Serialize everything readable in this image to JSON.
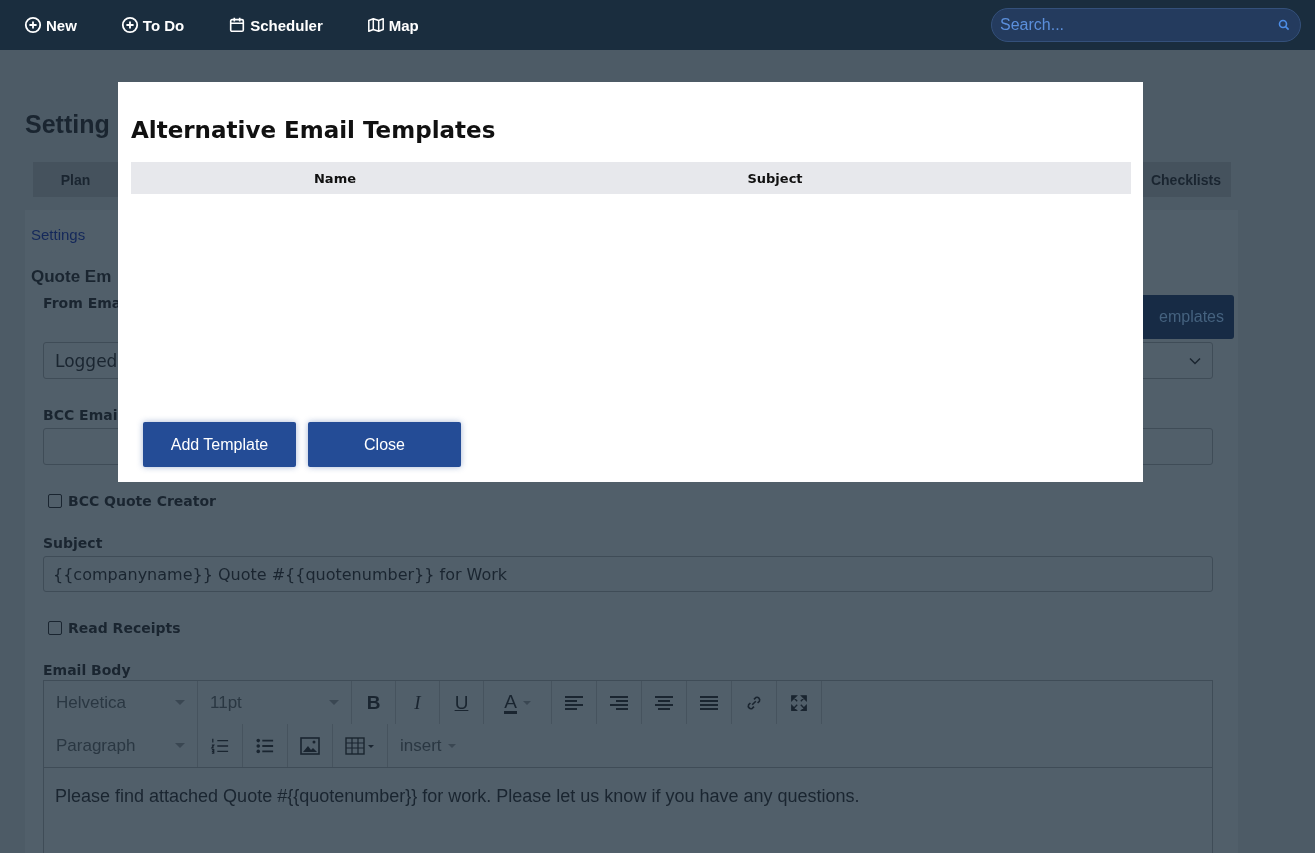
{
  "topbar": {
    "items": [
      {
        "kind": "plus",
        "label": "New"
      },
      {
        "kind": "plus",
        "label": "To Do"
      },
      {
        "kind": "calendar",
        "label": "Scheduler"
      },
      {
        "kind": "map",
        "label": "Map"
      }
    ],
    "search": {
      "placeholder": "Search..."
    }
  },
  "page": {
    "title": "Setting",
    "tabs": [
      {
        "label": "Plan",
        "selected": false
      },
      {
        "label": "Checklists",
        "selected": false
      }
    ],
    "breadcrumb": [
      "Settings"
    ],
    "section_title": "Quote Em",
    "from_email": {
      "label": "From Ema",
      "value": "Logged"
    },
    "templates_button": "emplates",
    "bcc_email": {
      "label": "BCC Emai"
    },
    "bcc_quote_creator": {
      "label": "BCC Quote Creator",
      "checked": false
    },
    "subject": {
      "label": "Subject",
      "value": "{{companyname}} Quote #{{quotenumber}} for Work"
    },
    "read_receipts": {
      "label": "Read Receipts",
      "checked": false
    },
    "email_body": {
      "label": "Email Body",
      "toolbar_rows": [
        [
          {
            "kind": "select",
            "label": "Helvetica"
          },
          {
            "kind": "select",
            "label": "11pt"
          },
          {
            "kind": "bold",
            "label": "B"
          },
          {
            "kind": "italic",
            "label": "I"
          },
          {
            "kind": "underline",
            "label": "U"
          },
          {
            "kind": "color",
            "label": "A"
          },
          {
            "kind": "align-left"
          },
          {
            "kind": "align-right"
          },
          {
            "kind": "align-center"
          },
          {
            "kind": "justify"
          },
          {
            "kind": "link"
          },
          {
            "kind": "fullscreen"
          }
        ],
        [
          {
            "kind": "select",
            "label": "Paragraph"
          },
          {
            "kind": "ordered-list"
          },
          {
            "kind": "bullet-list"
          },
          {
            "kind": "image"
          },
          {
            "kind": "table"
          },
          {
            "kind": "menu",
            "label": "insert"
          }
        ]
      ],
      "content": "Please find attached Quote #{{quotenumber}} for work. Please let us know if you have any questions."
    }
  },
  "modal": {
    "title": "Alternative Email Templates",
    "columns": [
      "Name",
      "Subject"
    ],
    "buttons": [
      "Add Template",
      "Close"
    ]
  }
}
